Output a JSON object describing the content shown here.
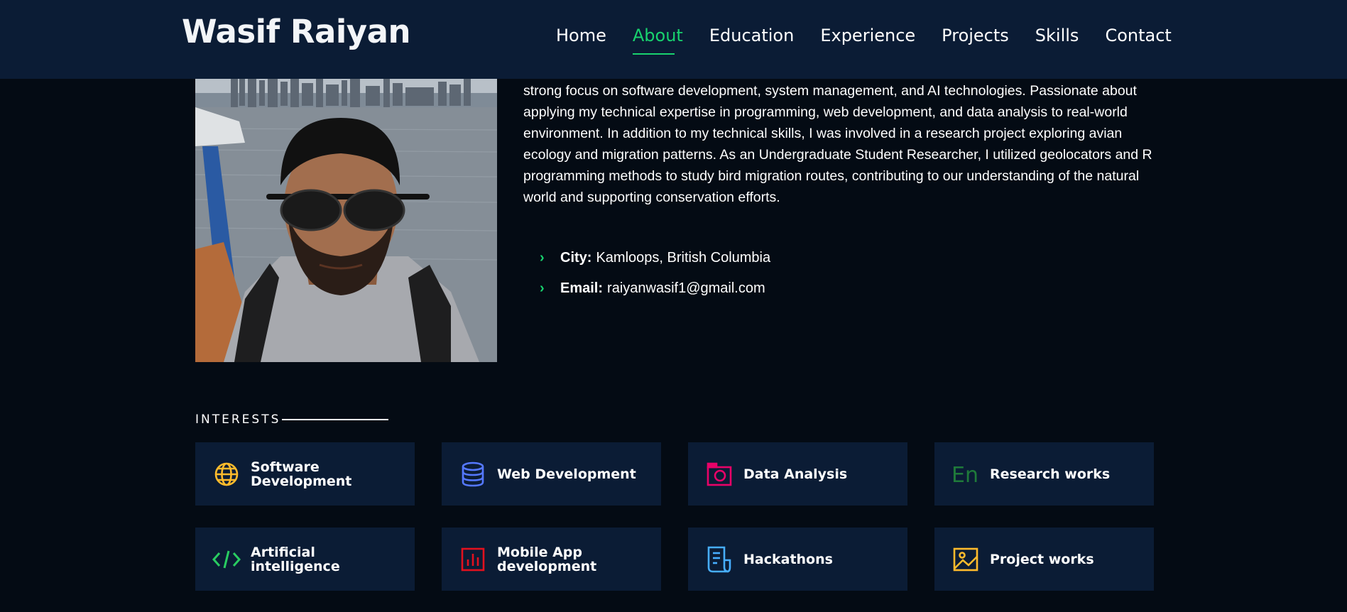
{
  "header": {
    "logo": "Wasif Raiyan",
    "nav": [
      "Home",
      "About",
      "Education",
      "Experience",
      "Projects",
      "Skills",
      "Contact"
    ],
    "active_nav": "About"
  },
  "about": {
    "paragraph_partial": "and data management, I am eager to contribute to research projects and co-op opportunities, with a strong focus on software development, system management, and AI technologies. Passionate about applying my technical expertise in programming, web development, and data analysis to real-world environment. In addition to my technical skills, I was involved in a research project exploring avian ecology and migration patterns. As an Undergraduate Student Researcher, I utilized geolocators and R programming methods to study bird migration routes, contributing to our understanding of the natural world and supporting conservation efforts.",
    "city_label": "City:",
    "city_value": "Kamloops, British Columbia",
    "email_label": "Email:",
    "email_value": "raiyanwasif1@gmail.com"
  },
  "interests": {
    "title": "INTERESTS",
    "items": [
      {
        "label": "Software Development",
        "icon": "globe-icon",
        "color": "#ffbb2c"
      },
      {
        "label": "Web Development",
        "icon": "database-icon",
        "color": "#5578ff"
      },
      {
        "label": "Data Analysis",
        "icon": "camera-icon",
        "color": "#e80368"
      },
      {
        "label": "Research works",
        "icon": "language-icon",
        "color": "#1f7a3a"
      },
      {
        "label": "Artificial intelligence",
        "icon": "code-icon",
        "color": "#29cc61"
      },
      {
        "label": "Mobile App development",
        "icon": "bar-chart-icon",
        "color": "#e2111e"
      },
      {
        "label": "Hackathons",
        "icon": "document-icon",
        "color": "#47aeff"
      },
      {
        "label": "Project works",
        "icon": "image-icon",
        "color": "#ffbb2c"
      }
    ]
  },
  "colors": {
    "background": "#040b14",
    "header_bg": "#0b1c35",
    "card_bg": "#0b1c35",
    "accent": "#18d26e"
  }
}
